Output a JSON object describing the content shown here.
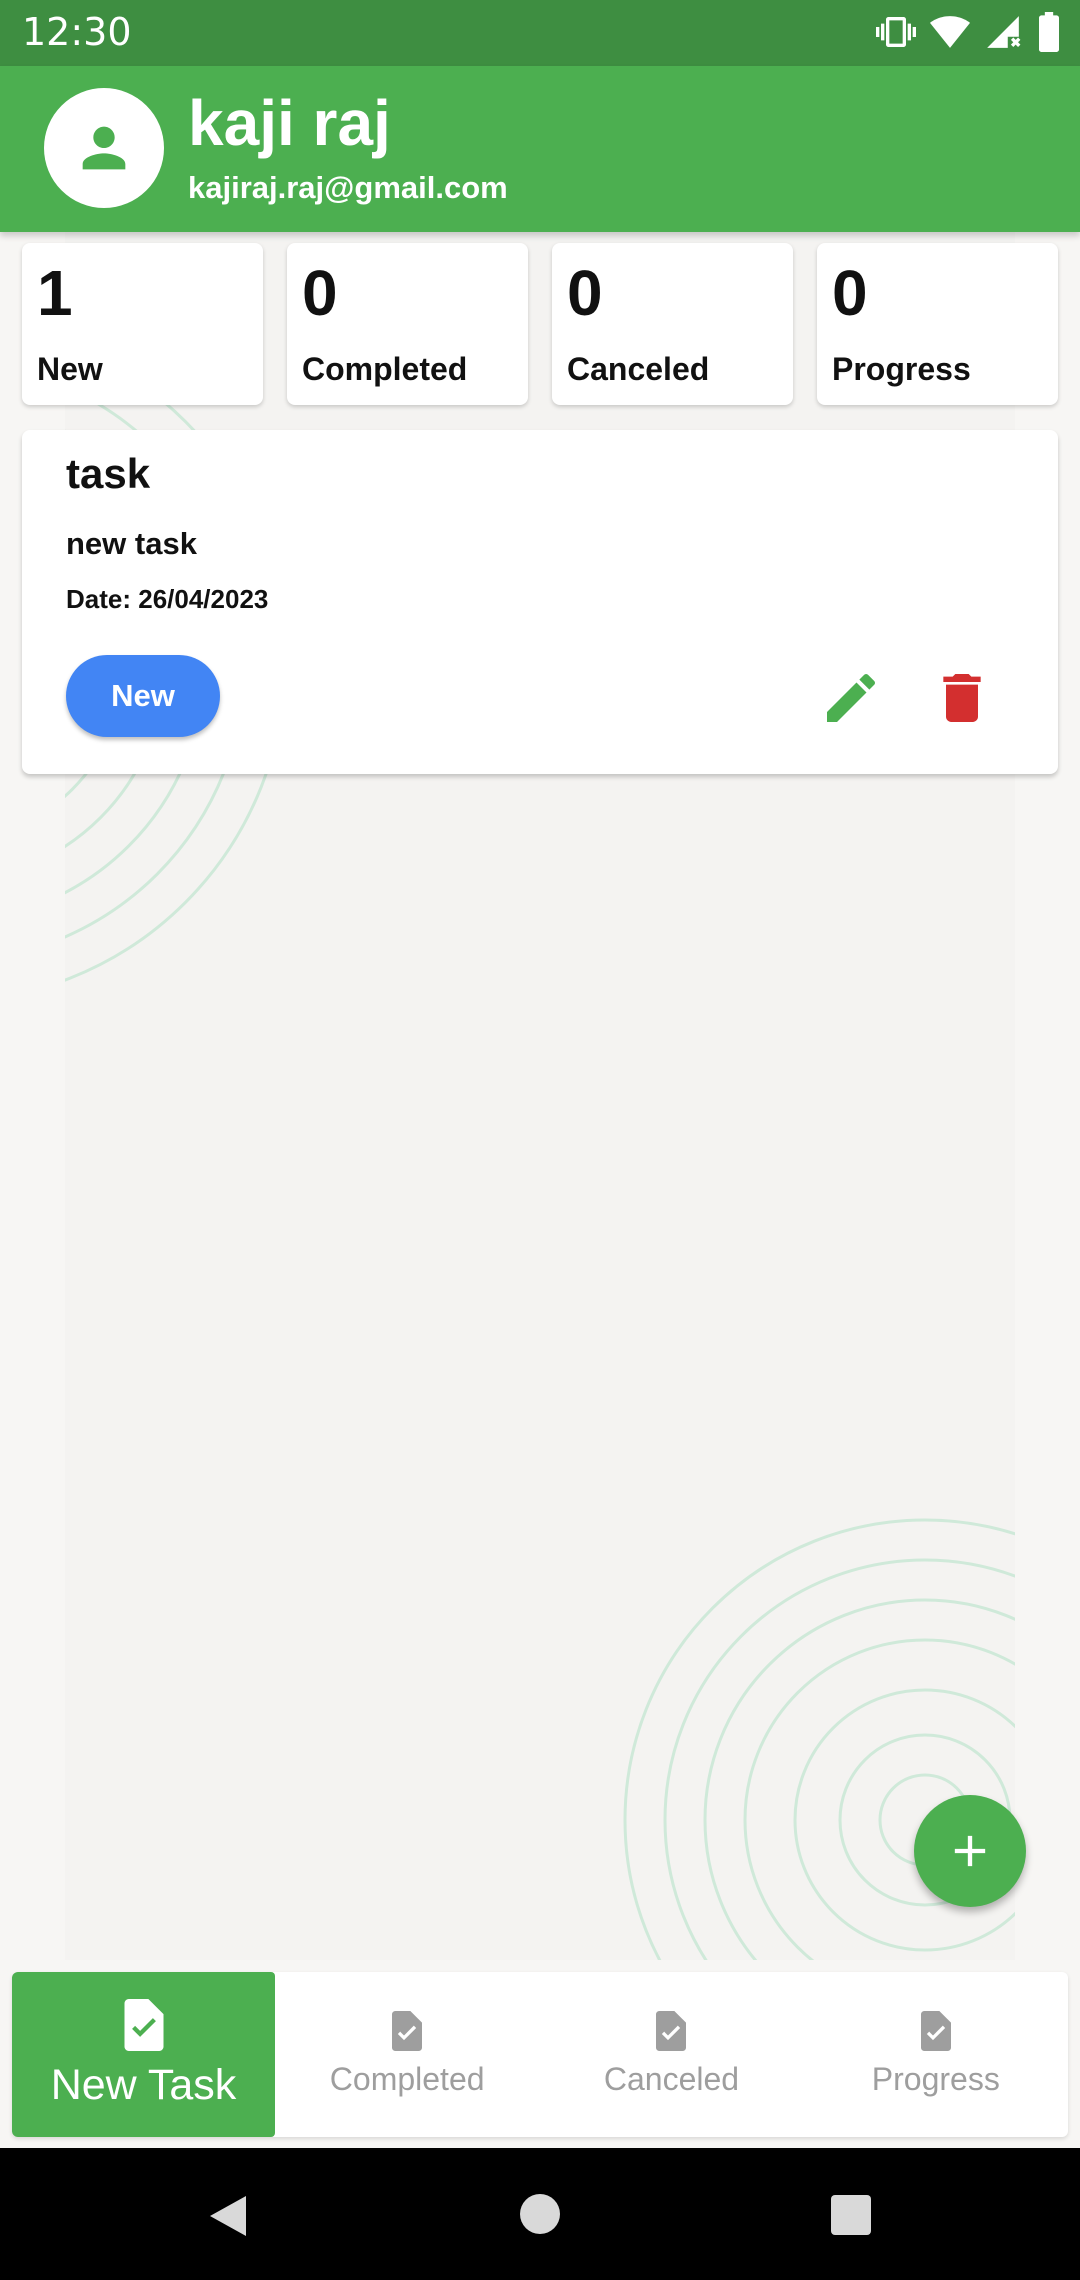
{
  "status_bar": {
    "time": "12:30",
    "icons": [
      "vibrate-icon",
      "wifi-icon",
      "signal-icon",
      "battery-icon"
    ]
  },
  "header": {
    "name": "kaji raj",
    "email": "kajiraj.raj@gmail.com",
    "avatar_icon": "person-icon"
  },
  "summary": [
    {
      "count": "1",
      "label": "New"
    },
    {
      "count": "0",
      "label": "Completed"
    },
    {
      "count": "0",
      "label": "Canceled"
    },
    {
      "count": "0",
      "label": "Progress"
    }
  ],
  "task": {
    "title": "task",
    "description": "new task",
    "date": "Date: 26/04/2023",
    "status": "New",
    "status_color": "#4285f4",
    "edit_icon": "pencil-icon",
    "delete_icon": "trash-icon"
  },
  "fab": {
    "icon": "plus-icon"
  },
  "bottom_nav": [
    {
      "label": "New Task",
      "icon": "task-file-icon",
      "active": true
    },
    {
      "label": "Completed",
      "icon": "task-file-icon",
      "active": false
    },
    {
      "label": "Canceled",
      "icon": "task-file-icon",
      "active": false
    },
    {
      "label": "Progress",
      "icon": "task-file-icon",
      "active": false
    }
  ],
  "colors": {
    "primary": "#4caf50",
    "status_bar": "#3e8e41",
    "accent_blue": "#4285f4",
    "delete_red": "#d32f2f"
  }
}
